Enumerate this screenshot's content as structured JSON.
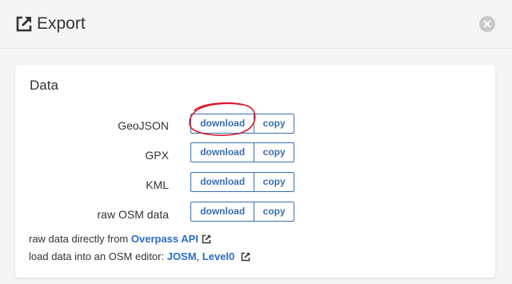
{
  "header": {
    "title": "Export",
    "icon": "external-link-icon",
    "close_icon": "close-icon"
  },
  "card": {
    "title": "Data"
  },
  "formats": [
    {
      "label": "GeoJSON",
      "download": "download",
      "copy": "copy"
    },
    {
      "label": "GPX",
      "download": "download",
      "copy": "copy"
    },
    {
      "label": "KML",
      "download": "download",
      "copy": "copy"
    },
    {
      "label": "raw OSM data",
      "download": "download",
      "copy": "copy"
    }
  ],
  "raw_line": {
    "prefix": "raw data directly from ",
    "link": "Overpass API"
  },
  "editor_line": {
    "prefix": "load data into an OSM editor: ",
    "link1": "JOSM",
    "sep": ", ",
    "link2": "Level0"
  },
  "colors": {
    "accent": "#3a6fb0",
    "link": "#2b6cc4",
    "annotation": "#d9182d"
  }
}
